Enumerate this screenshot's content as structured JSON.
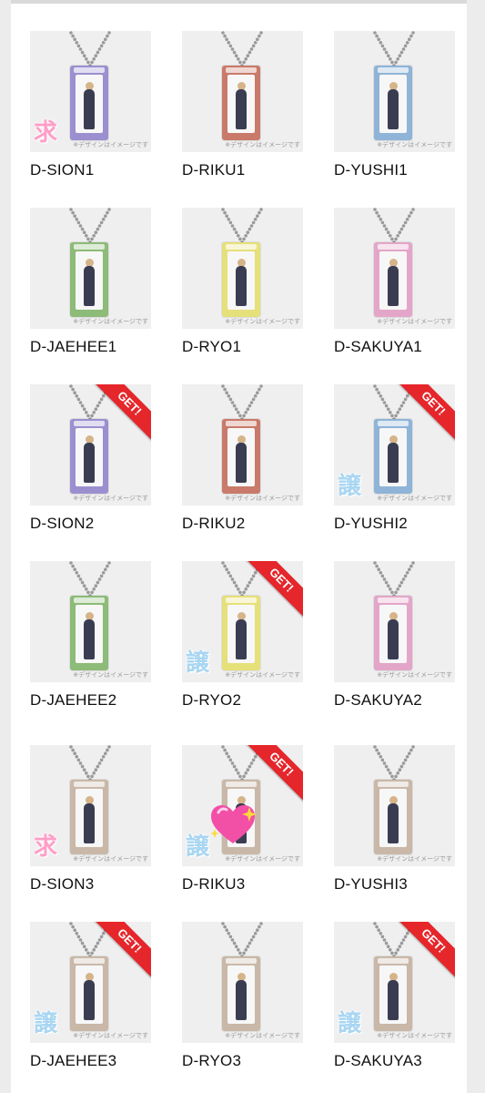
{
  "caption": "※デザインはイメージです",
  "get_label": "GET!",
  "stamps": {
    "want": "求",
    "give": "譲"
  },
  "items": [
    {
      "name": "D-SION1",
      "color": "#9c8fd0",
      "get": false,
      "stamp": "want"
    },
    {
      "name": "D-RIKU1",
      "color": "#c97a6a",
      "get": false,
      "stamp": ""
    },
    {
      "name": "D-YUSHI1",
      "color": "#8fb4d8",
      "get": false,
      "stamp": ""
    },
    {
      "name": "D-JAEHEE1",
      "color": "#8dbb78",
      "get": false,
      "stamp": ""
    },
    {
      "name": "D-RYO1",
      "color": "#e6e07a",
      "get": false,
      "stamp": ""
    },
    {
      "name": "D-SAKUYA1",
      "color": "#e3a6c8",
      "get": false,
      "stamp": ""
    },
    {
      "name": "D-SION2",
      "color": "#9c8fd0",
      "get": true,
      "stamp": ""
    },
    {
      "name": "D-RIKU2",
      "color": "#c97a6a",
      "get": false,
      "stamp": ""
    },
    {
      "name": "D-YUSHI2",
      "color": "#8fb4d8",
      "get": true,
      "stamp": "give"
    },
    {
      "name": "D-JAEHEE2",
      "color": "#8dbb78",
      "get": false,
      "stamp": ""
    },
    {
      "name": "D-RYO2",
      "color": "#e6e07a",
      "get": true,
      "stamp": "give"
    },
    {
      "name": "D-SAKUYA2",
      "color": "#e3a6c8",
      "get": false,
      "stamp": ""
    },
    {
      "name": "D-SION3",
      "color": "#c9b8a8",
      "get": false,
      "stamp": "want"
    },
    {
      "name": "D-RIKU3",
      "color": "#c9b8a8",
      "get": true,
      "stamp": "give",
      "heart": true
    },
    {
      "name": "D-YUSHI3",
      "color": "#c9b8a8",
      "get": false,
      "stamp": ""
    },
    {
      "name": "D-JAEHEE3",
      "color": "#c9b8a8",
      "get": true,
      "stamp": "give"
    },
    {
      "name": "D-RYO3",
      "color": "#c9b8a8",
      "get": false,
      "stamp": ""
    },
    {
      "name": "D-SAKUYA3",
      "color": "#c9b8a8",
      "get": true,
      "stamp": "give"
    }
  ]
}
